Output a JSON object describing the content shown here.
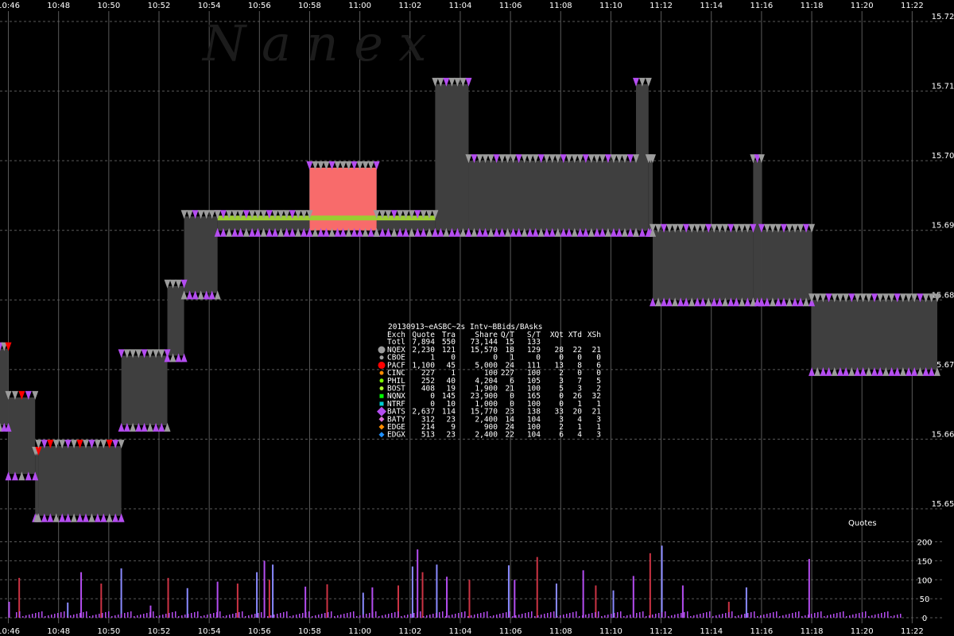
{
  "watermark": "N   a   n   e   x",
  "colors": {
    "background": "#000000",
    "nbbo_fill": "#3f3f3f",
    "nqex": "#9c9c9c",
    "bats": "#b44df0",
    "pacf": "#ff0000",
    "bid_line": "#9acd32",
    "highlight_fill": "#f86b6b"
  },
  "chart_data": [
    {
      "type": "area",
      "title": "",
      "xlabel": "",
      "ylabel": "",
      "x_ticks": [
        "10:46",
        "10:48",
        "10:50",
        "10:52",
        "10:54",
        "10:56",
        "10:58",
        "11:00",
        "11:02",
        "11:04",
        "11:06",
        "11:08",
        "11:10",
        "11:12",
        "11:14",
        "11:16",
        "11:18",
        "11:20",
        "11:22"
      ],
      "y_ticks": [
        15.65,
        15.66,
        15.67,
        15.68,
        15.69,
        15.7,
        15.71,
        15.72
      ],
      "xlim": [
        "10:45:40",
        "11:23:40"
      ],
      "ylim": [
        15.65,
        15.72
      ],
      "grid": true,
      "series": [
        {
          "name": "",
          "note": "best bid / best ask spread",
          "segments": [
            {
              "start": "10:45:40",
              "end": "10:46:00",
              "bid": 15.662,
              "ask": 15.673
            },
            {
              "start": "10:46:00",
              "end": "10:47:04",
              "bid": 15.655,
              "ask": 15.666
            },
            {
              "start": "10:47:04",
              "end": "10:47:12",
              "bid": 15.649,
              "ask": 15.658
            },
            {
              "start": "10:47:12",
              "end": "10:50:30",
              "bid": 15.649,
              "ask": 15.659
            },
            {
              "start": "10:50:30",
              "end": "10:52:20",
              "bid": 15.662,
              "ask": 15.672
            },
            {
              "start": "10:52:20",
              "end": "10:53:00",
              "bid": 15.672,
              "ask": 15.682
            },
            {
              "start": "10:53:00",
              "end": "10:54:20",
              "bid": 15.681,
              "ask": 15.692
            },
            {
              "start": "10:54:20",
              "end": "10:58:00",
              "bid": 15.69,
              "ask": 15.692
            },
            {
              "start": "10:58:00",
              "end": "11:00:40",
              "bid": 15.69,
              "ask": 15.699
            },
            {
              "start": "11:00:40",
              "end": "11:03:00",
              "bid": 15.69,
              "ask": 15.692
            },
            {
              "start": "11:03:00",
              "end": "11:04:20",
              "bid": 15.69,
              "ask": 15.711
            },
            {
              "start": "11:04:20",
              "end": "11:11:00",
              "bid": 15.69,
              "ask": 15.7
            },
            {
              "start": "11:11:00",
              "end": "11:11:30",
              "bid": 15.69,
              "ask": 15.711
            },
            {
              "start": "11:11:30",
              "end": "11:11:40",
              "bid": 15.69,
              "ask": 15.7
            },
            {
              "start": "11:11:40",
              "end": "11:15:40",
              "bid": 15.68,
              "ask": 15.69
            },
            {
              "start": "11:15:40",
              "end": "11:16:00",
              "bid": 15.68,
              "ask": 15.7
            },
            {
              "start": "11:16:00",
              "end": "11:18:00",
              "bid": 15.68,
              "ask": 15.69
            },
            {
              "start": "11:18:00",
              "end": "11:23:00",
              "bid": 15.67,
              "ask": 15.68
            }
          ]
        }
      ],
      "highlight": {
        "start": "10:58:00",
        "end": "11:00:40",
        "bid": 15.69,
        "ask": 15.699
      },
      "stats_table": {
        "title": "20130913~eASBC~2s Intv~BBids/BAsks",
        "headers": [
          "Exch",
          "Quote",
          "Tra",
          "Share",
          "Q/T",
          "S/T",
          "XQt",
          "XTd",
          "XSh"
        ],
        "totl": [
          "Totl",
          "7,894",
          "550",
          "73,144",
          "15",
          "133",
          "",
          "",
          ""
        ],
        "rows": [
          {
            "exch": "NQEX",
            "quote": "2,230",
            "tra": "121",
            "share": "15,570",
            "qt": "18",
            "st": "129",
            "xqt": "28",
            "xtd": "22",
            "xsh": "21",
            "color": "#9c9c9c",
            "marker": "hex"
          },
          {
            "exch": "CBOE",
            "quote": "1",
            "tra": "0",
            "share": "0",
            "qt": "1",
            "st": "0",
            "xqt": "0",
            "xtd": "0",
            "xsh": "0",
            "color": "#a0a0a0",
            "marker": "dot"
          },
          {
            "exch": "PACF",
            "quote": "1,100",
            "tra": "45",
            "share": "5,000",
            "qt": "24",
            "st": "111",
            "xqt": "13",
            "xtd": "8",
            "xsh": "6",
            "color": "#ff0000",
            "marker": "hex"
          },
          {
            "exch": "CINC",
            "quote": "227",
            "tra": "1",
            "share": "100",
            "qt": "227",
            "st": "100",
            "xqt": "2",
            "xtd": "0",
            "xsh": "0",
            "color": "#ff8c00",
            "marker": "dot"
          },
          {
            "exch": "PHIL",
            "quote": "252",
            "tra": "40",
            "share": "4,204",
            "qt": "6",
            "st": "105",
            "xqt": "3",
            "xtd": "7",
            "xsh": "5",
            "color": "#7cfc00",
            "marker": "dot"
          },
          {
            "exch": "BOST",
            "quote": "408",
            "tra": "19",
            "share": "1,900",
            "qt": "21",
            "st": "100",
            "xqt": "5",
            "xtd": "3",
            "xsh": "2",
            "color": "#adff2f",
            "marker": "dot"
          },
          {
            "exch": "NQNX",
            "quote": "0",
            "tra": "145",
            "share": "23,900",
            "qt": "0",
            "st": "165",
            "xqt": "0",
            "xtd": "26",
            "xsh": "32",
            "color": "#00ff00",
            "marker": "square"
          },
          {
            "exch": "NTRF",
            "quote": "0",
            "tra": "10",
            "share": "1,000",
            "qt": "0",
            "st": "100",
            "xqt": "0",
            "xtd": "1",
            "xsh": "1",
            "color": "#00ced1",
            "marker": "square"
          },
          {
            "exch": "BATS",
            "quote": "2,637",
            "tra": "114",
            "share": "15,770",
            "qt": "23",
            "st": "138",
            "xqt": "33",
            "xtd": "20",
            "xsh": "21",
            "color": "#b44df0",
            "marker": "diamond"
          },
          {
            "exch": "BATY",
            "quote": "312",
            "tra": "23",
            "share": "2,400",
            "qt": "14",
            "st": "104",
            "xqt": "3",
            "xtd": "4",
            "xsh": "3",
            "color": "#da70d6",
            "marker": "diamond"
          },
          {
            "exch": "EDGE",
            "quote": "214",
            "tra": "9",
            "share": "900",
            "qt": "24",
            "st": "100",
            "xqt": "2",
            "xtd": "1",
            "xsh": "1",
            "color": "#ff8c00",
            "marker": "diamond"
          },
          {
            "exch": "EDGX",
            "quote": "513",
            "tra": "23",
            "share": "2,400",
            "qt": "22",
            "st": "104",
            "xqt": "6",
            "xtd": "4",
            "xsh": "3",
            "color": "#1e90ff",
            "marker": "diamond"
          }
        ]
      }
    },
    {
      "type": "bar",
      "title": "",
      "panel_label": "Quotes",
      "y_ticks": [
        0,
        50,
        100,
        150,
        200
      ],
      "ylim": [
        0,
        220
      ],
      "series": [
        {
          "name": "",
          "x": [
            "10:46:00",
            "10:46:24",
            "10:48:20",
            "10:48:52",
            "10:49:40",
            "10:50:28",
            "10:51:38",
            "10:52:20",
            "10:53:06",
            "10:54:18",
            "10:55:06",
            "10:55:52",
            "10:56:10",
            "10:56:22",
            "10:56:30",
            "10:57:48",
            "10:58:40",
            "11:00:06",
            "11:00:28",
            "11:01:30",
            "11:02:04",
            "11:02:16",
            "11:02:28",
            "11:03:02",
            "11:03:26",
            "11:04:20",
            "11:05:54",
            "11:06:08",
            "11:07:02",
            "11:07:48",
            "11:08:52",
            "11:09:22",
            "11:10:04",
            "11:10:52",
            "11:11:32",
            "11:12:00",
            "11:12:50",
            "11:14:40",
            "11:15:22",
            "11:17:52"
          ],
          "values": [
            42,
            105,
            40,
            120,
            90,
            130,
            32,
            105,
            78,
            95,
            90,
            120,
            150,
            100,
            140,
            82,
            88,
            66,
            80,
            85,
            135,
            180,
            120,
            140,
            108,
            100,
            138,
            100,
            160,
            90,
            125,
            85,
            72,
            110,
            170,
            190,
            85,
            42,
            80,
            155
          ]
        }
      ]
    }
  ]
}
